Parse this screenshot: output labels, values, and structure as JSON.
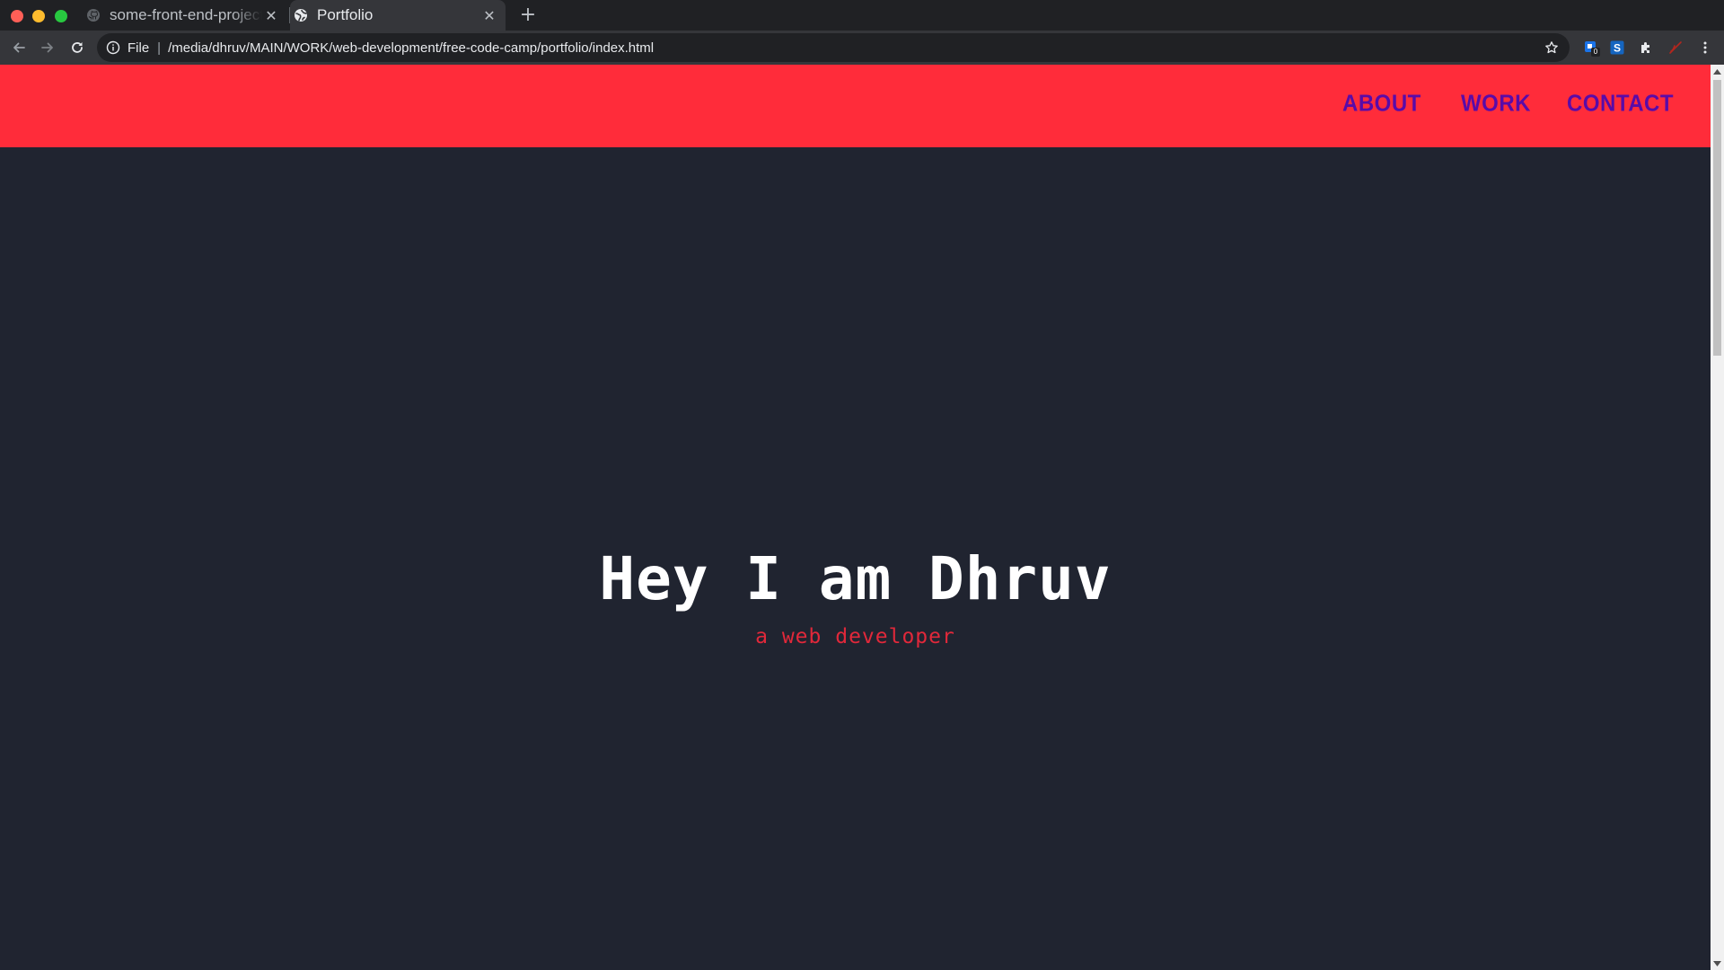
{
  "browser": {
    "tabs": [
      {
        "title": "some-front-end-projects",
        "favicon": "github-icon",
        "active": false
      },
      {
        "title": "Portfolio",
        "favicon": "globe-icon",
        "active": true
      }
    ],
    "address": {
      "scheme_label": "File",
      "url": "/media/dhruv/MAIN/WORK/web-development/free-code-camp/portfolio/index.html"
    },
    "extensions": [
      {
        "icon": "extension-blue-icon",
        "badge": "0"
      },
      {
        "icon": "extension-s-icon"
      },
      {
        "icon": "puzzle-icon"
      },
      {
        "icon": "extension-slashed-icon"
      }
    ]
  },
  "site": {
    "nav": {
      "about": "ABOUT",
      "work": "WORK",
      "contact": "CONTACT"
    },
    "hero": {
      "title": "Hey I am Dhruv",
      "subtitle": "a web developer"
    }
  },
  "colors": {
    "navbar_bg": "#ff2c3a",
    "nav_link": "#5a0ba8",
    "page_bg": "#202430",
    "hero_title": "#ffffff",
    "hero_subtitle": "#e1283a"
  }
}
